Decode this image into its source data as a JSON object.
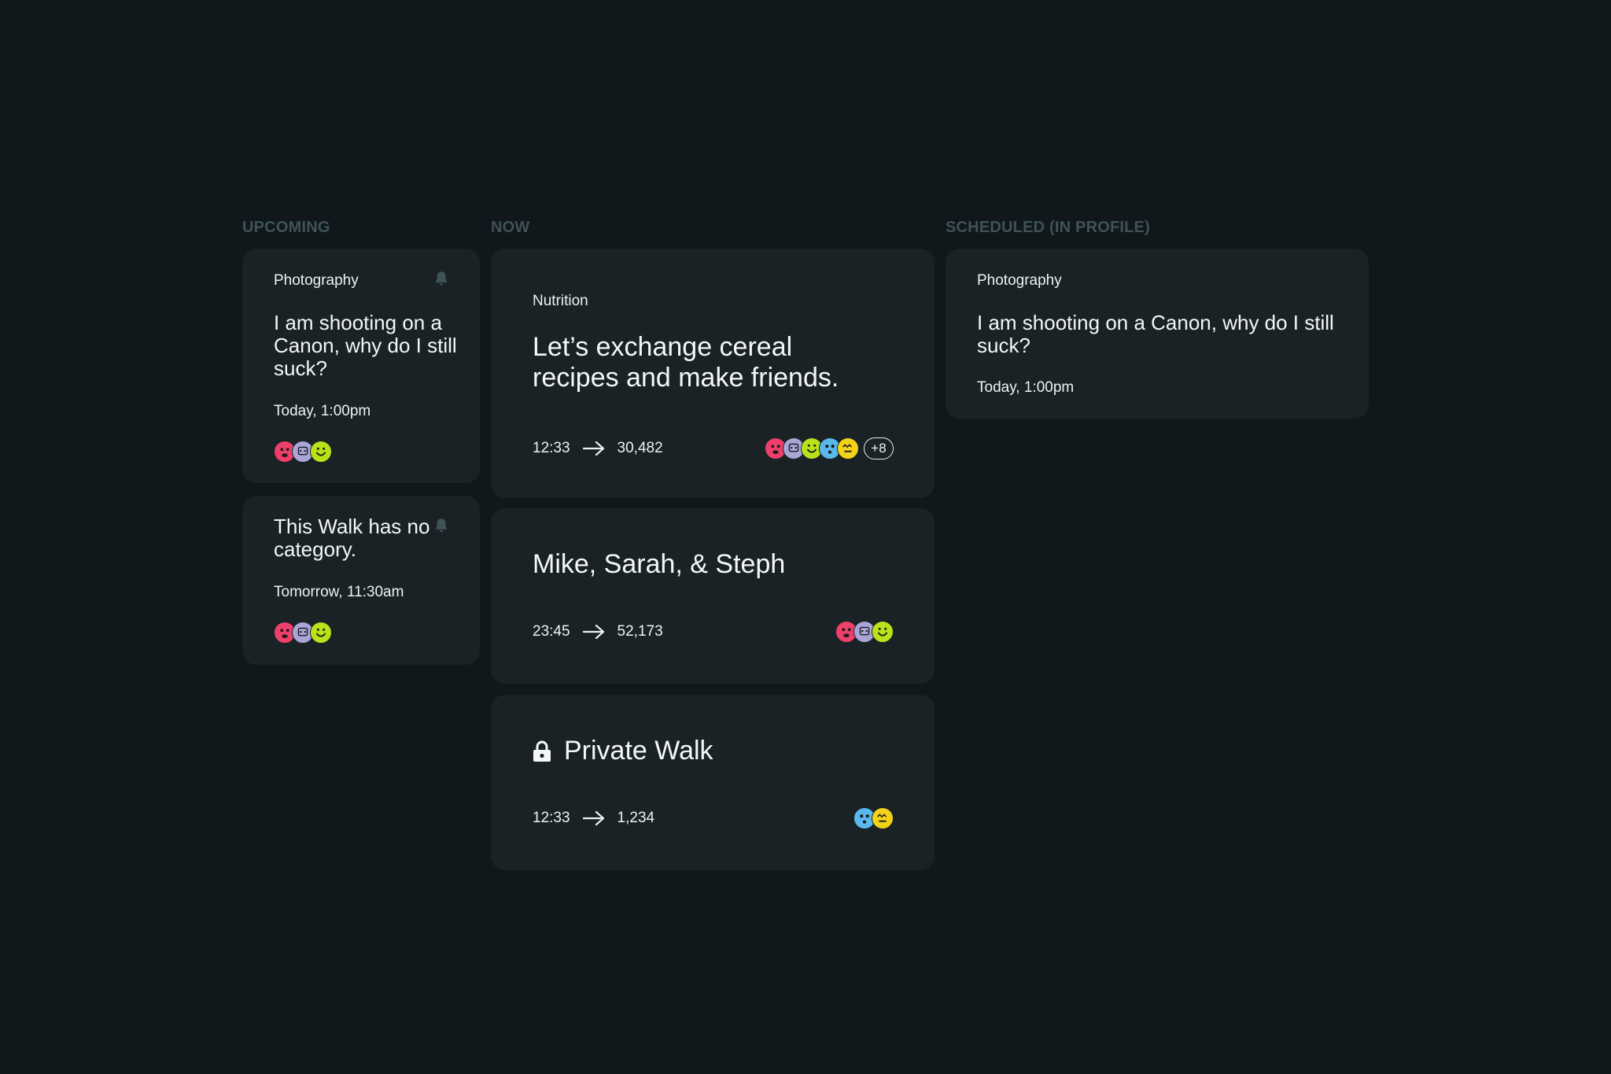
{
  "columns": {
    "upcoming": "UPCOMING",
    "now": "NOW",
    "scheduled": "SCHEDULED (IN PROFILE)"
  },
  "upcoming": [
    {
      "category": "Photography",
      "title": "I am shooting on a Canon, why do I still suck?",
      "day": "Today,",
      "time": "1:00pm",
      "icon": "bell-icon",
      "avatars": [
        "pink",
        "lavender",
        "lime"
      ]
    },
    {
      "category": "",
      "title": "This Walk has no category.",
      "day": "Tomorrow,",
      "time": "11:30am",
      "icon": "bell-icon",
      "avatars": [
        "pink",
        "lavender",
        "lime"
      ]
    }
  ],
  "now": [
    {
      "category": "Nutrition",
      "title": "Let’s exchange cereal recipes and make friends.",
      "duration": "12:33",
      "count": "30,482",
      "avatars": [
        "pink",
        "lavender",
        "lime",
        "blue",
        "yellow"
      ],
      "more": "+8"
    },
    {
      "title": "Mike, Sarah, & Steph",
      "duration": "23:45",
      "count": "52,173",
      "avatars": [
        "pink",
        "lavender",
        "lime"
      ]
    },
    {
      "title": "Private Walk",
      "icon": "lock-icon",
      "duration": "12:33",
      "count": "1,234",
      "avatars": [
        "blue",
        "yellow"
      ]
    }
  ],
  "scheduled": [
    {
      "category": "Photography",
      "title": "I am shooting on a Canon, why do I still suck?",
      "day": "Today,",
      "time": "1:00pm"
    }
  ],
  "colors": {
    "background": "#10181b",
    "card": "#1a2226",
    "label": "#3f5257",
    "pink": "#ee3f6b",
    "lavender": "#a9a5d6",
    "lime": "#b9e21a",
    "blue": "#5ab8ec",
    "yellow": "#f3d21b"
  }
}
